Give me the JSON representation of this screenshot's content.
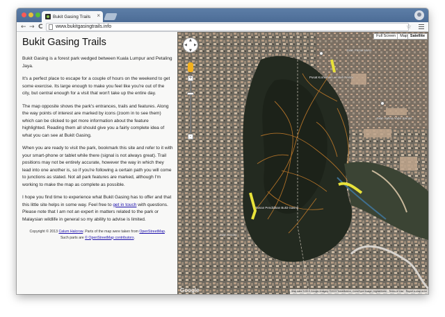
{
  "browser": {
    "tab_title": "Bukit Gasing Trails",
    "tab_close": "×",
    "url": "www.bukitgasingtrails.info",
    "back_glyph": "←",
    "forward_glyph": "→",
    "reload_glyph": "C",
    "star_glyph": "☆",
    "icons": [
      "favicon-icon",
      "back-icon",
      "forward-icon",
      "reload-icon",
      "page-icon",
      "star-icon",
      "menu-icon",
      "profile-icon"
    ]
  },
  "sidebar": {
    "title": "Bukit Gasing Trails",
    "p1": "Bukit Gasing is a forest park wedged between Kuala Lumpur and Petaling Jaya.",
    "p2": "It's a perfect place to escape for a couple of hours on the weekend to get some exercise. Its large enough to make you feel like you're out of the city, but central enough for a visit that won't take up the entire day.",
    "p3": "The map opposite shows the park's entrances, trails and features. Along the way points of interest are marked by icons (zoom in to see them) which can be clicked to get more information about the feature highlighted. Reading them all should give you a fairly complete idea of what you can see at Bukit Gasing.",
    "p4": "When you are ready to visit the park, bookmark this site and refer to it with your smart-phone or tablet while there (signal is not always great). Trail positions may not be entirely accurate, however the way in which they lead into one another is, so if you're following a certain path you will come to junctions as stated. Not all park features are marked, although I'm working to make the map as complete as possible.",
    "p5_before": "I hope you find time to experience what Bukit Gasing has to offer and that this little site helps in some way. Feel free to ",
    "p5_link": "get in touch",
    "p5_after": " with questions. Please note that I am not an expert in matters related to the park or Malaysian wildlife in general so my ability to advise is limited.",
    "footer": {
      "copy_before": "Copyright © 2013 ",
      "author_link": "Calum Halcrow",
      "copy_after": ". Parts of the map were taken from ",
      "osm_link": "OpenStreetMap",
      "mid": ". Such parts are ",
      "osm_contrib_link": "© OpenStreetMap contributors",
      "end": "."
    }
  },
  "map": {
    "fullscreen_label": "Full Screen",
    "map_label": "Map",
    "satellite_label": "Satellite",
    "zoom_in": "+",
    "zoom_out": "-",
    "google_logo": "Google",
    "attribution": "Map data ©2013 Google Imagery ©2013 TerraMetrics, Cnes/Spot Image, DigitalGlobe · Terms of Use · Report a map error",
    "labels": {
      "jalan_pantai": "Jalan Pantai Murni",
      "pusat": "Pusat Komersial Lembah Pantai",
      "jalan_sultan": "Jalan Sultan Abdul Samad",
      "taman": "Taman Pendidikan Bukit Gasing",
      "jalan_gasing": "Jalan Gasing"
    },
    "trail_color": "#c07a2a",
    "highlight_color": "#e8e23a"
  }
}
